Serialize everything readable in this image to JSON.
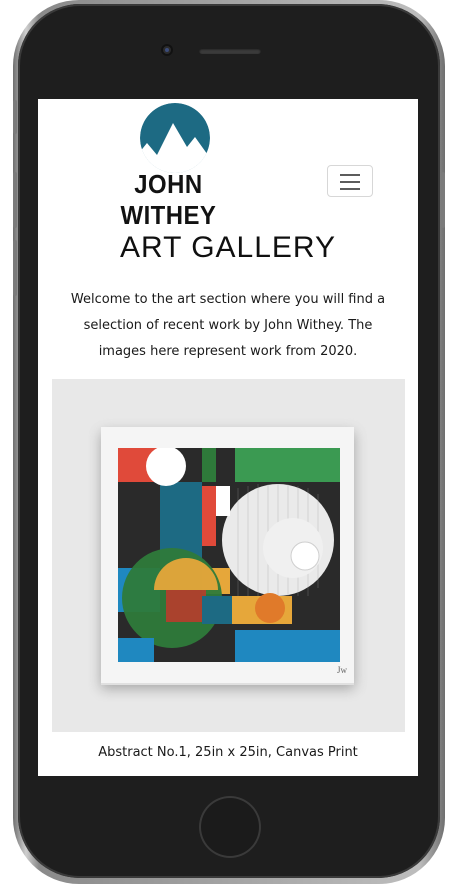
{
  "header": {
    "logo_text": "JOHN WITHEY",
    "logo_mark_color": "#1d6a83",
    "menu_icon": "hamburger-icon"
  },
  "main": {
    "title": "ART GALLERY",
    "intro": "Welcome to the art section where you will find a selection of recent work by John Withey. The images here represent work from 2020.",
    "artwork": {
      "caption": "Abstract No.1, 25in x 25in, Canvas Print",
      "signature": "Jw"
    }
  },
  "colors": {
    "accent_blue": "#1d6a83",
    "art_red": "#e04a3a",
    "art_green": "#3b9a52",
    "art_blue": "#1f88c0",
    "art_orange": "#e07a2a",
    "art_yellow": "#e6a73a",
    "art_black": "#2a2a2a"
  }
}
